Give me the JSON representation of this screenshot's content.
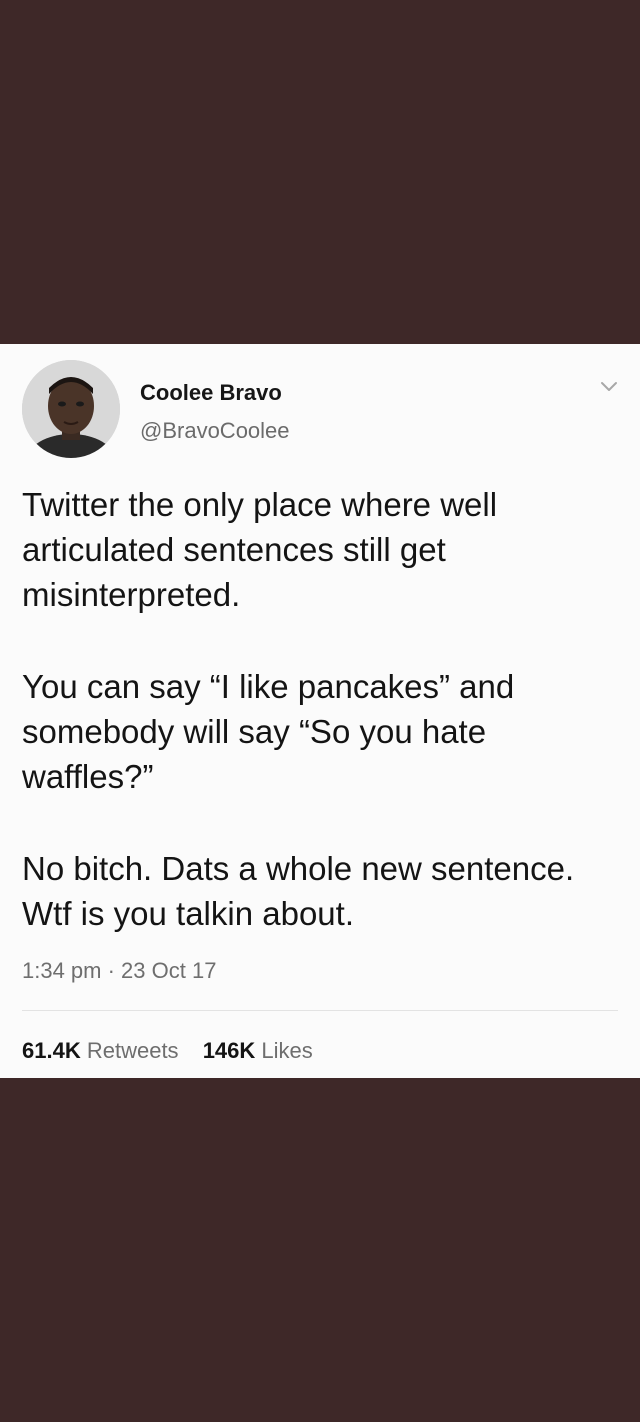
{
  "tweet": {
    "display_name": "Coolee Bravo",
    "handle": "@BravoCoolee",
    "menu_icon": "chevron-down-icon",
    "avatar_icon": "avatar-photo",
    "paragraphs": [
      "Twitter the only place where well articulated sentences still get misinterpreted.",
      "You can say “I like pancakes” and somebody will say “So you hate waffles?”",
      "No bitch. Dats a whole new sentence. Wtf is you talkin about."
    ],
    "timestamp": "1:34 pm · 23 Oct 17",
    "retweets_count": "61.4K",
    "retweets_label": "Retweets",
    "likes_count": "146K",
    "likes_label": "Likes"
  },
  "colors": {
    "background": "#3e2828",
    "card": "#fbfbfb",
    "text": "#141414",
    "muted": "#6e6e6e"
  }
}
